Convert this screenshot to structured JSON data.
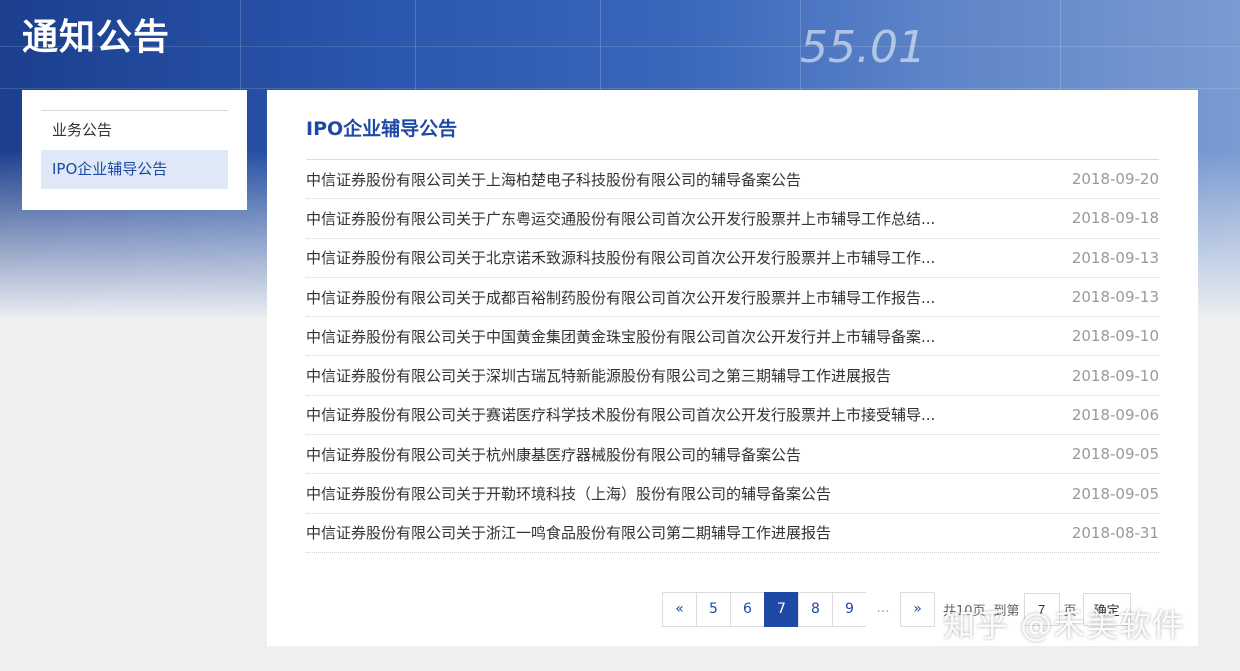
{
  "header": {
    "title": "通知公告",
    "ticker_text": "55.01"
  },
  "sidebar": {
    "items": [
      {
        "label": "业务公告",
        "active": false
      },
      {
        "label": "IPO企业辅导公告",
        "active": true
      }
    ]
  },
  "main": {
    "section_title": "IPO企业辅导公告",
    "notices": [
      {
        "title": "中信证券股份有限公司关于上海柏楚电子科技股份有限公司的辅导备案公告",
        "date": "2018-09-20"
      },
      {
        "title": "中信证券股份有限公司关于广东粤运交通股份有限公司首次公开发行股票并上市辅导工作总结...",
        "date": "2018-09-18"
      },
      {
        "title": "中信证券股份有限公司关于北京诺禾致源科技股份有限公司首次公开发行股票并上市辅导工作...",
        "date": "2018-09-13"
      },
      {
        "title": "中信证券股份有限公司关于成都百裕制药股份有限公司首次公开发行股票并上市辅导工作报告...",
        "date": "2018-09-13"
      },
      {
        "title": "中信证券股份有限公司关于中国黄金集团黄金珠宝股份有限公司首次公开发行并上市辅导备案...",
        "date": "2018-09-10"
      },
      {
        "title": "中信证券股份有限公司关于深圳古瑞瓦特新能源股份有限公司之第三期辅导工作进展报告",
        "date": "2018-09-10"
      },
      {
        "title": "中信证券股份有限公司关于赛诺医疗科学技术股份有限公司首次公开发行股票并上市接受辅导...",
        "date": "2018-09-06"
      },
      {
        "title": "中信证券股份有限公司关于杭州康基医疗器械股份有限公司的辅导备案公告",
        "date": "2018-09-05"
      },
      {
        "title": "中信证券股份有限公司关于开勒环境科技（上海）股份有限公司的辅导备案公告",
        "date": "2018-09-05"
      },
      {
        "title": "中信证券股份有限公司关于浙江一鸣食品股份有限公司第二期辅导工作进展报告",
        "date": "2018-08-31"
      }
    ]
  },
  "pagination": {
    "prev": "«",
    "pages": [
      "5",
      "6",
      "7",
      "8",
      "9"
    ],
    "current": "7",
    "ellipsis": "...",
    "next": "»",
    "total_text": "共10页",
    "goto_prefix": "到第",
    "goto_value": "7",
    "goto_suffix": "页",
    "confirm_label": "确定"
  },
  "watermark": {
    "text": "知乎 @禾美软件"
  }
}
